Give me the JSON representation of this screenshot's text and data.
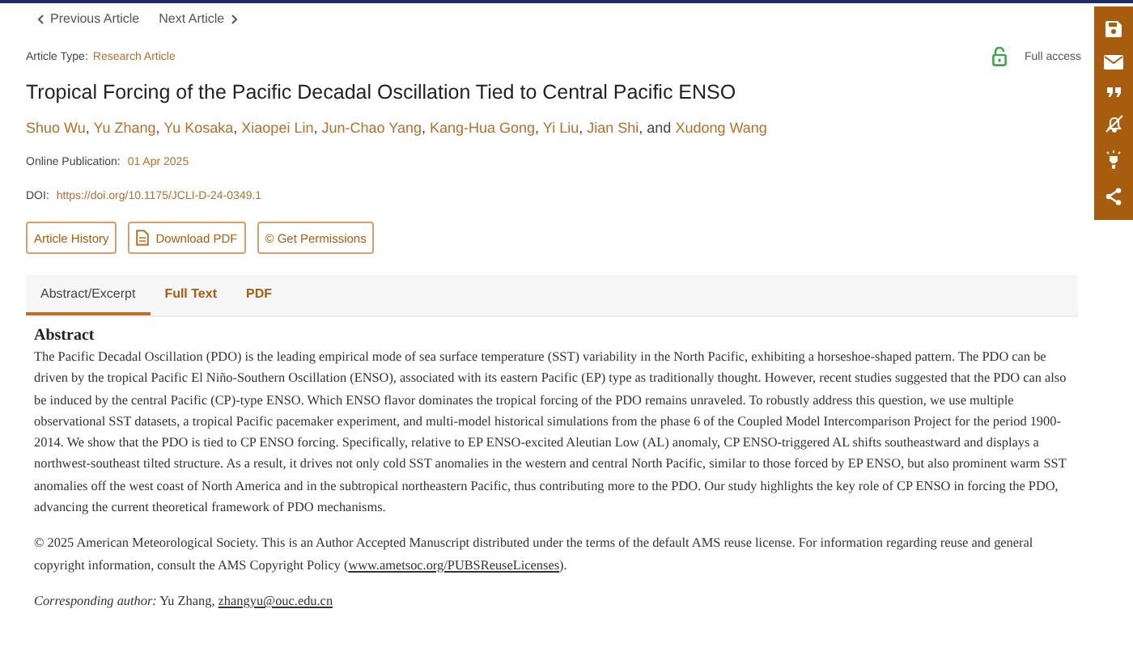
{
  "nav": {
    "previous": "Previous Article",
    "next": "Next Article"
  },
  "article_type": {
    "label": "Article Type:",
    "value": "Research Article"
  },
  "access": {
    "label": "Full access"
  },
  "title": "Tropical Forcing of the Pacific Decadal Oscillation Tied to Central Pacific ENSO",
  "authors": [
    {
      "name": "Shuo Wu",
      "sep": ","
    },
    {
      "name": "Yu Zhang",
      "sep": ","
    },
    {
      "name": "Yu Kosaka",
      "sep": ","
    },
    {
      "name": "Xiaopei Lin",
      "sep": ","
    },
    {
      "name": "Jun-Chao Yang",
      "sep": ","
    },
    {
      "name": "Kang-Hua Gong",
      "sep": ","
    },
    {
      "name": "Yi Liu",
      "sep": ","
    },
    {
      "name": "Jian Shi",
      "sep": ", and"
    },
    {
      "name": "Xudong Wang"
    }
  ],
  "publication": {
    "label": "Online Publication:",
    "value": "01 Apr 2025"
  },
  "doi": {
    "label": "DOI:",
    "value": "https://doi.org/10.1175/JCLI-D-24-0349.1"
  },
  "actions": [
    {
      "label": "Article History",
      "kind": "plain"
    },
    {
      "label": "Download PDF",
      "kind": "download"
    },
    {
      "label": "© Get Permissions",
      "kind": "plain"
    }
  ],
  "tabs": [
    {
      "label": "Abstract/Excerpt",
      "selected": true
    },
    {
      "label": "Full Text",
      "selected": false
    },
    {
      "label": "PDF",
      "selected": false
    }
  ],
  "abstract": {
    "heading": "Abstract",
    "text": "The Pacific Decadal Oscillation (PDO) is the leading empirical mode of sea surface temperature (SST) variability in the North Pacific, exhibiting a horseshoe-shaped pattern. The PDO can be driven by the tropical Pacific El Niño-Southern Oscillation (ENSO), associated with its eastern Pacific (EP) type as traditionally thought. However, recent studies suggested that the PDO can also be induced by the central Pacific (CP)-type ENSO. Which ENSO flavor dominates the tropical forcing of the PDO remains unraveled. To robustly address this question, we use multiple observational SST datasets, a tropical Pacific pacemaker experiment, and multi-model historical simulations from the phase 6 of the Coupled Model Intercomparison Project for the period 1900-2014. We show that the PDO is tied to CP ENSO forcing. Specifically, relative to EP ENSO-excited Aleutian Low (AL) anomaly, CP ENSO-triggered AL shifts southeastward and displays a northwest-southeast tilted structure. As a result, it drives not only cold SST anomalies in the western and central North Pacific, similar to those forced by EP ENSO, but also prominent warm SST anomalies off the west coast of North America and in the subtropical northeastern Pacific, thus contributing more to the PDO. Our study highlights the key role of CP ENSO in forcing the PDO, advancing the current theoretical framework of PDO mechanisms."
  },
  "copyright": {
    "before": "© 2025 American Meteorological Society. This is an Author Accepted Manuscript distributed under the terms of the default AMS reuse license. For information regarding reuse and general copyright information, consult the AMS Copyright Policy (",
    "link": "www.ametsoc.org/PUBSReuseLicenses",
    "after": ")."
  },
  "corresponding": {
    "label": "Corresponding author:",
    "name": "Yu Zhang,",
    "email": "zhangyu@ouc.edu.cn"
  },
  "toolbar": [
    {
      "kind": "save"
    },
    {
      "kind": "email"
    },
    {
      "kind": "quote"
    },
    {
      "kind": "alert-off"
    },
    {
      "kind": "lightbulb"
    },
    {
      "kind": "share"
    }
  ]
}
